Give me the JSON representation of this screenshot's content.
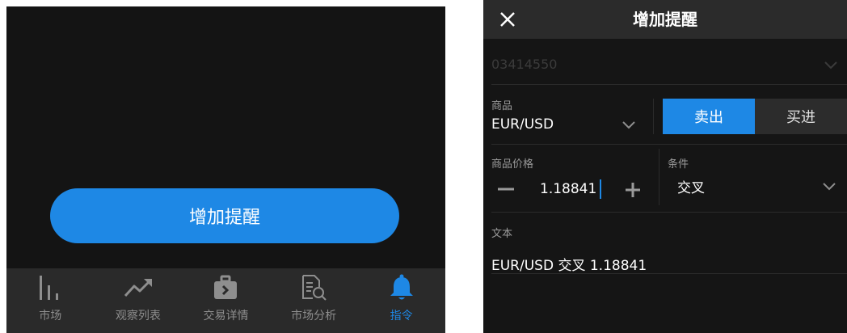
{
  "left": {
    "add_alert_button": "增加提醒",
    "tabs": [
      {
        "label": "市场",
        "icon": "bar-chart-icon",
        "active": false
      },
      {
        "label": "观察列表",
        "icon": "trend-up-icon",
        "active": false
      },
      {
        "label": "交易详情",
        "icon": "briefcase-icon",
        "active": false
      },
      {
        "label": "市场分析",
        "icon": "document-search-icon",
        "active": false
      },
      {
        "label": "指令",
        "icon": "bell-icon",
        "active": true
      }
    ]
  },
  "right": {
    "title": "增加提醒",
    "account_number": "03414550",
    "product": {
      "label": "商品",
      "value": "EUR/USD"
    },
    "direction": {
      "sell": "卖出",
      "buy": "买进",
      "selected": "sell"
    },
    "price": {
      "label": "商品价格",
      "value": "1.18841"
    },
    "condition": {
      "label": "条件",
      "value": "交叉"
    },
    "text": {
      "label": "文本",
      "value": "EUR/USD 交叉 1.18841"
    }
  },
  "colors": {
    "accent": "#1e88e5",
    "bg": "#141414",
    "tabbar": "#2a2a2a",
    "header": "#2b2b2b"
  }
}
